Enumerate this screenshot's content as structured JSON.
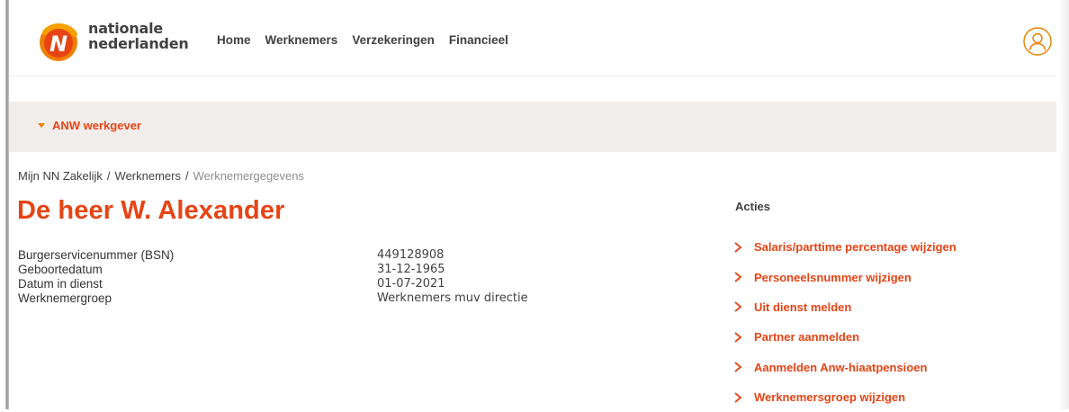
{
  "brand": {
    "logo_line1": "nationale",
    "logo_line2": "nederlanden",
    "logo_letter": "N",
    "accent_color": "#e64415",
    "accent_light": "#ee7f00"
  },
  "nav": [
    {
      "label": "Home"
    },
    {
      "label": "Werknemers"
    },
    {
      "label": "Verzekeringen"
    },
    {
      "label": "Financieel"
    }
  ],
  "header": {
    "user_icon": "user-circle-icon"
  },
  "collapsible": {
    "label": "ANW werkgever",
    "icon": "caret-down-icon"
  },
  "breadcrumb": {
    "items": [
      "Mijn NN Zakelijk",
      "Werknemers"
    ],
    "separator": "/",
    "current": "Werknemergegevens"
  },
  "employee": {
    "title": "De heer W. Alexander",
    "details": [
      {
        "label": "Burgerservicenummer (BSN)",
        "value": "449128908"
      },
      {
        "label": "Geboortedatum",
        "value": "31-12-1965"
      },
      {
        "label": "Datum in dienst",
        "value": "01-07-2021"
      },
      {
        "label": "Werknemergroep",
        "value": "Werknemers muv directie"
      }
    ]
  },
  "actions": {
    "title": "Acties",
    "items": [
      {
        "label": "Salaris/parttime percentage wijzigen"
      },
      {
        "label": "Personeelsnummer wijzigen"
      },
      {
        "label": "Uit dienst melden"
      },
      {
        "label": "Partner aanmelden"
      },
      {
        "label": "Aanmelden Anw-hiaatpensioen"
      },
      {
        "label": "Werknemersgroep wijzigen"
      }
    ]
  }
}
